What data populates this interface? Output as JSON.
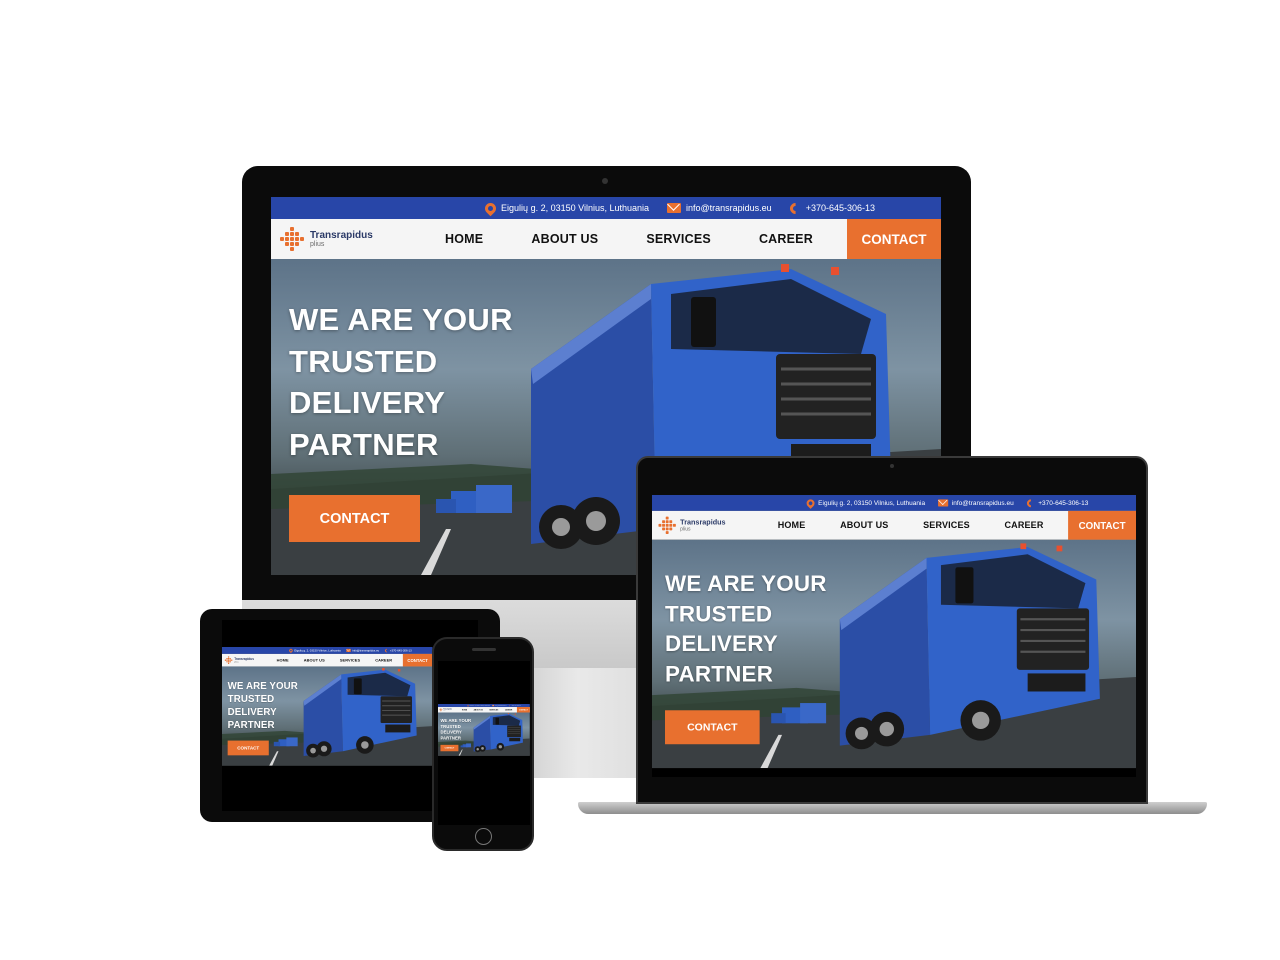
{
  "site": {
    "topbar": {
      "address": "Eigulių g. 2, 03150 Vilnius, Luthuania",
      "email": "info@transrapidus.eu",
      "phone": "+370-645-306-13"
    },
    "brand": {
      "name": "Transrapidus",
      "sub": "plius"
    },
    "nav": {
      "home": "HOME",
      "about": "ABOUT US",
      "services": "SERVICES",
      "career": "CAREER",
      "contact": "CONTACT"
    },
    "hero": {
      "line1": "WE ARE YOUR",
      "line2": "TRUSTED",
      "line3": "DELIVERY",
      "line4": "PARTNER",
      "button": "CONTACT"
    }
  },
  "colors": {
    "topbar": "#2846a8",
    "accent": "#e8702f",
    "navbar": "#f5f5f5",
    "truck": "#2f5fc2"
  },
  "icons": [
    "location-pin-icon",
    "mail-icon",
    "phone-icon",
    "logo-icon"
  ]
}
